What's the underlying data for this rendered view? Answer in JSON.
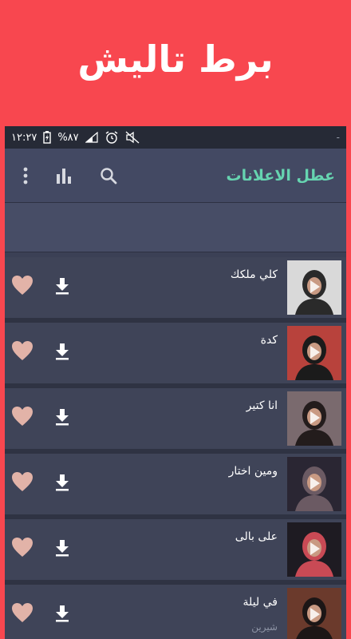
{
  "banner": {
    "title": "برط تاليش"
  },
  "status_bar": {
    "time": "١٢:٢٧",
    "battery": "%٨٧",
    "extra": "-"
  },
  "toolbar": {
    "title": "عطل الاعلانات",
    "icons": [
      "more-vert-icon",
      "equalizer-icon",
      "search-icon"
    ]
  },
  "songs": [
    {
      "title": "كلي ملكك",
      "subtitle": "",
      "thumb_bg": "#d9d9d9",
      "thumb_fg": "#2a2a2a"
    },
    {
      "title": "كدة",
      "subtitle": "",
      "thumb_bg": "#b8423c",
      "thumb_fg": "#1b1b1b"
    },
    {
      "title": "انا كتير",
      "subtitle": "",
      "thumb_bg": "#7a6a6e",
      "thumb_fg": "#231c1c"
    },
    {
      "title": "ومين اختار",
      "subtitle": "",
      "thumb_bg": "#2a2633",
      "thumb_fg": "#6b5a63"
    },
    {
      "title": "على بالى",
      "subtitle": "",
      "thumb_bg": "#1e1b22",
      "thumb_fg": "#c94a55"
    },
    {
      "title": "في ليلة",
      "subtitle": "شيرين",
      "thumb_bg": "#6b3a2c",
      "thumb_fg": "#1c1616"
    }
  ],
  "colors": {
    "banner": "#f8474f",
    "accent_title": "#66d4b0",
    "heart": "#e2b3a8",
    "row_bg": "#3f4458"
  }
}
